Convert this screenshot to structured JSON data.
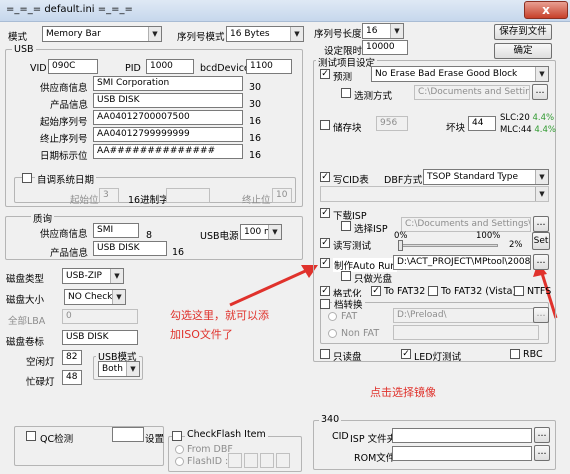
{
  "window": {
    "title": "=_=_=   default.ini   =_=_=",
    "close": "x"
  },
  "top": {
    "mode_label": "模式",
    "mode_value": "Memory Bar",
    "serial_mode_label": "序列号模式",
    "serial_mode_value": "16 Bytes",
    "serial_len_label": "序列号长度",
    "serial_len_value": "16",
    "time_limit_label": "设定限时",
    "time_limit_value": "10000",
    "save_button": "保存到文件",
    "ok_button": "确定"
  },
  "usb": {
    "group_title": "USB",
    "vid_label": "VID",
    "vid_value": "090C",
    "pid_label": "PID",
    "pid_value": "1000",
    "bcd_label": "bcdDevice",
    "bcd_value": "1100",
    "vendor_label": "供应商信息",
    "vendor_value": "SMI Corporation",
    "vendor_len": "30",
    "product_label": "产品信息",
    "product_value": "USB DISK",
    "product_len": "30",
    "start_serial_label": "起始序列号",
    "start_serial_value": "AA04012700007500",
    "start_serial_len": "16",
    "end_serial_label": "终止序列号",
    "end_serial_value": "AA04012799999999",
    "end_serial_len": "16",
    "date_label": "日期标示位",
    "date_value": "AA##############",
    "date_len": "16",
    "auto_date_label": "自调系统日期",
    "start_pos_label": "起始位",
    "start_pos_value": "3",
    "hex_label": "16进制字",
    "hex_value": "",
    "end_pos_label": "终止位",
    "end_pos_value": "10"
  },
  "quality": {
    "group_title": "质询",
    "vendor_label": "供应商信息",
    "vendor_value": "SMI",
    "vendor_len": "8",
    "power_label": "USB电源",
    "power_value": "100 mA",
    "product_label": "产品信息",
    "product_value": "USB DISK",
    "product_len": "16"
  },
  "disk": {
    "type_label": "磁盘类型",
    "type_value": "USB-ZIP",
    "size_label": "磁盘大小",
    "size_value": "NO Check",
    "lba_label": "全部LBA",
    "lba_value": "0",
    "volume_label": "磁盘卷标",
    "volume_value": "USB DISK",
    "idle_label": "空闲灯",
    "idle_value": "82",
    "busy_label": "忙碌灯",
    "busy_value": "48",
    "usb_mode_title": "USB模式",
    "usb_mode_value": "Both"
  },
  "test": {
    "group_title": "测试项目设定",
    "pretest_label": "预测",
    "pretest_value": "No Erase Bad Erase Good Block",
    "select_mode_label": "选测方式",
    "select_mode_path": "C:\\Documents and Settings\\pit",
    "storage_label": "储存块",
    "storage_value": "956",
    "bad_block_label": "坏块",
    "bad_block_value": "44",
    "slc_label": "SLC:20",
    "slc_pct": "4.4%",
    "mlc_label": "MLC:44",
    "mlc_pct": "4.4%",
    "cid_label": "写CID表",
    "dbf_label": "DBF方式",
    "dbf_value": "TSOP Standard Type",
    "download_isp_label": "下载ISP",
    "select_isp_label": "选择ISP",
    "isp_path": "C:\\Documents and Settings\\pitt.c",
    "rw_test_label": "读写测试",
    "rw_pct_left": "0%",
    "rw_pct_right": "100%",
    "rw_current": "2%",
    "set_button": "Set",
    "autorun_label": "制作Auto Run",
    "autorun_path": "D:\\ACT_PROJECT\\MPtool\\2008-05-2",
    "cd_only_label": "只做光盘",
    "format_label": "格式化",
    "fat32_label": "To FAT32",
    "fat32_vista_label": "To FAT32 (Vista)",
    "ntfs_label": "NTFS",
    "partition_label": "档转换",
    "fat_label": "FAT",
    "fat_path": "D:\\Preload\\",
    "nonfat_label": "Non FAT",
    "readonly_label": "只读盘",
    "led_label": "LED灯测试",
    "rbc_label": "RBC",
    "browse_button": "..."
  },
  "bottom": {
    "qc_label": "QC检测",
    "set_label": "设置",
    "cf_title": "CheckFlash Item",
    "from_dbf_label": "From DBF",
    "flash_id_label": "FlashID :",
    "g340_title": "340",
    "cid_label": "CID",
    "isp_file_label": "ISP 文件夹",
    "rom_file_label": "ROM文件"
  },
  "annotations": {
    "left_note_1": "勾选这里，就可以添",
    "left_note_2": "加ISO文件了",
    "right_note": "点击选择镜像"
  }
}
